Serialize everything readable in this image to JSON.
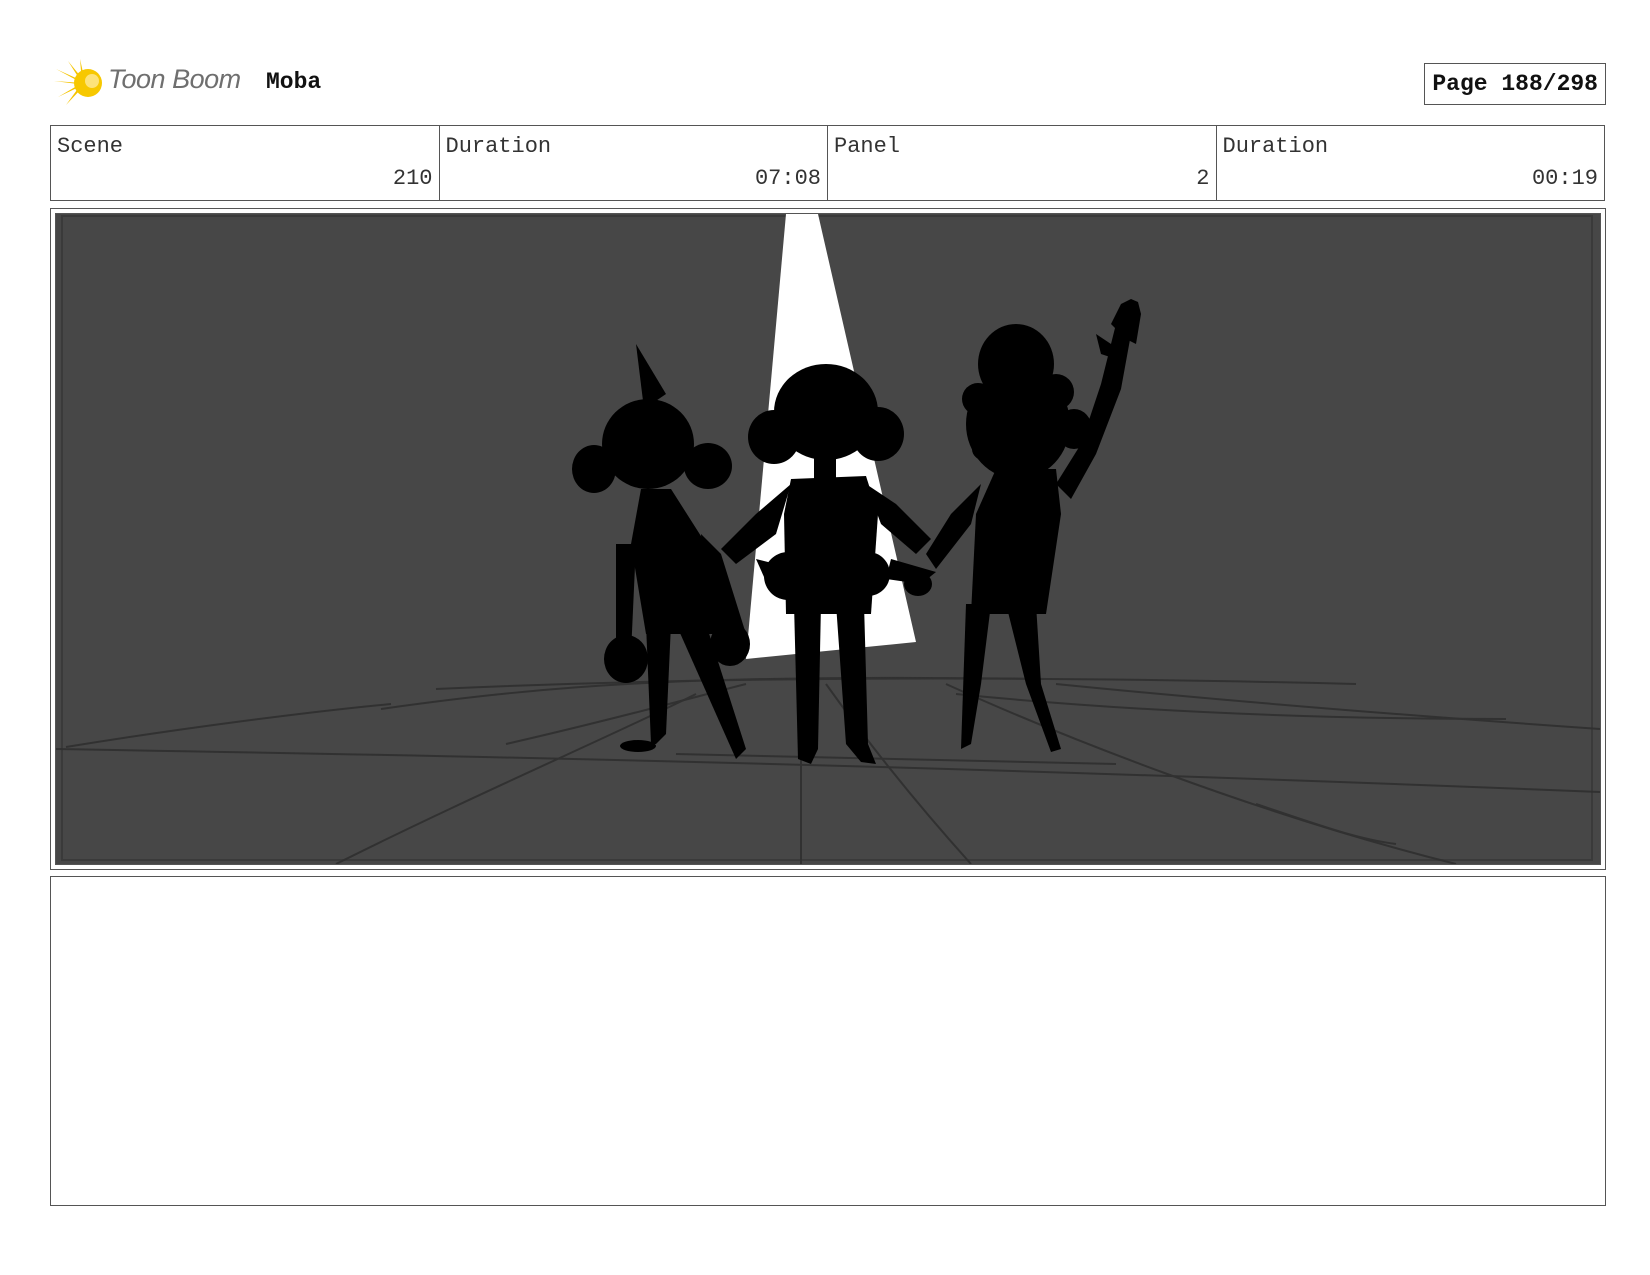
{
  "header": {
    "brand": "Toon Boom",
    "project": "Moba",
    "page": "Page 188/298"
  },
  "info": {
    "scene_label": "Scene",
    "scene_value": "210",
    "scene_duration_label": "Duration",
    "scene_duration_value": "07:08",
    "panel_label": "Panel",
    "panel_value": "2",
    "panel_duration_label": "Duration",
    "panel_duration_value": "00:19"
  },
  "colors": {
    "background": "#474747",
    "silhouette": "#000000",
    "spotlight": "#ffffff",
    "logo_accent": "#f5c400"
  },
  "icons": {
    "logo": "toon-boom-logo-icon"
  }
}
